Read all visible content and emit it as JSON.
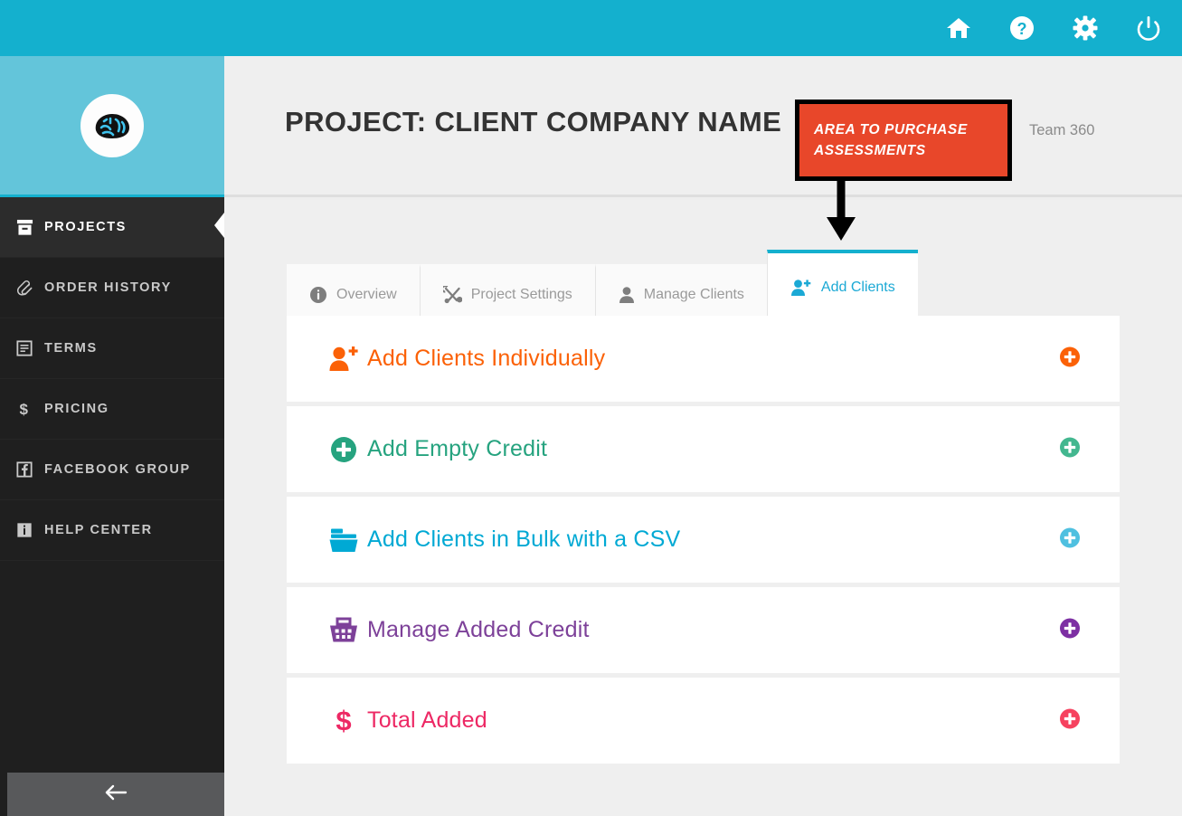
{
  "topbar": {
    "background": "#14b0ce",
    "icons": [
      {
        "name": "home-icon",
        "label": "Home"
      },
      {
        "name": "help-icon",
        "label": "Help"
      },
      {
        "name": "gear-icon",
        "label": "Settings"
      },
      {
        "name": "power-icon",
        "label": "Log Out"
      }
    ]
  },
  "sidebar": {
    "logo_name": "brain-logo",
    "background": "#1f1f1f",
    "brand_background": "#63c5da",
    "items": [
      {
        "label": "PROJECTS",
        "icon": "archive-box-icon",
        "active": true
      },
      {
        "label": "ORDER HISTORY",
        "icon": "paperclip-icon",
        "active": false
      },
      {
        "label": "TERMS",
        "icon": "document-lines-icon",
        "active": false
      },
      {
        "label": "PRICING",
        "icon": "dollar-sign-icon",
        "active": false
      },
      {
        "label": "FACEBOOK GROUP",
        "icon": "facebook-icon",
        "active": false
      },
      {
        "label": "HELP CENTER",
        "icon": "info-square-icon",
        "active": false
      }
    ],
    "back_button": {
      "name": "back-arrow-icon",
      "label": ""
    }
  },
  "header": {
    "title": "PROJECT: CLIENT COMPANY NAME",
    "team": "Team 360"
  },
  "callout": {
    "line1": "AREA TO PURCHASE",
    "line2": "ASSESSMENTS",
    "background": "#e8472a",
    "border": "#000000",
    "text_color": "#ffffff"
  },
  "tabs": [
    {
      "label": "Overview",
      "icon": "info-circle-icon",
      "active": false
    },
    {
      "label": "Project Settings",
      "icon": "tools-icon",
      "active": false
    },
    {
      "label": "Manage Clients",
      "icon": "user-icon",
      "active": false
    },
    {
      "label": "Add Clients",
      "icon": "user-plus-icon",
      "active": true
    }
  ],
  "rows": [
    {
      "label": "Add Clients Individually",
      "icon": "user-plus-icon",
      "color": "#fb6107",
      "plus": "plus-circle-icon"
    },
    {
      "label": "Add Empty Credit",
      "icon": "plus-circle-icon",
      "color": "#26a37f",
      "plus": "plus-circle-icon"
    },
    {
      "label": "Add Clients in Bulk with a CSV",
      "icon": "folder-icon",
      "color": "#00a9d4",
      "plus": "plus-circle-icon"
    },
    {
      "label": "Manage Added Credit",
      "icon": "basket-icon",
      "color": "#7d4199",
      "plus": "plus-circle-icon"
    },
    {
      "label": "Total Added",
      "icon": "dollar-sign-icon",
      "color": "#ed2864",
      "plus": "plus-circle-icon"
    }
  ],
  "row_plus_colors": [
    "#fb6107",
    "#43b78f",
    "#4fc0e0",
    "#7d2fa3",
    "#f6425f"
  ]
}
